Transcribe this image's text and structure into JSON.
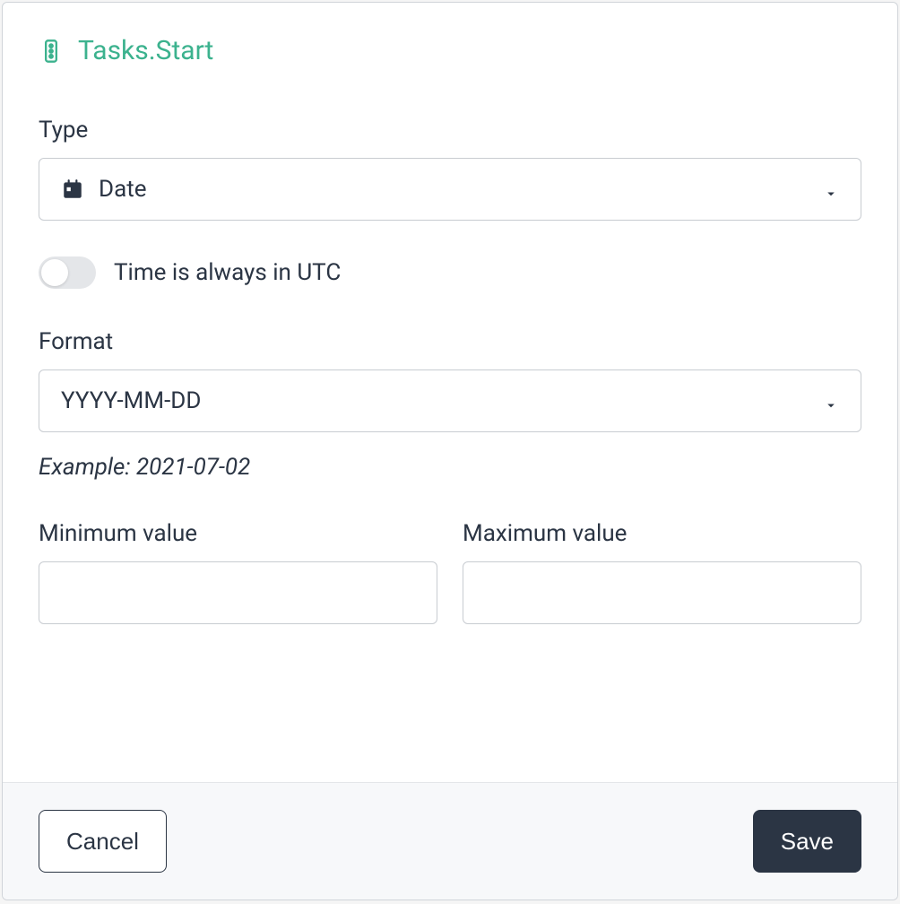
{
  "header": {
    "title": "Tasks.Start",
    "icon": "traffic-light-icon",
    "accent_color": "#3cb28e"
  },
  "form": {
    "type": {
      "label": "Type",
      "selected": "Date",
      "icon": "calendar-icon"
    },
    "utc_toggle": {
      "label": "Time is always in UTC",
      "enabled": false
    },
    "format": {
      "label": "Format",
      "selected": "YYYY-MM-DD"
    },
    "example": "Example: 2021-07-02",
    "min_value": {
      "label": "Minimum value",
      "value": ""
    },
    "max_value": {
      "label": "Maximum value",
      "value": ""
    }
  },
  "footer": {
    "cancel_label": "Cancel",
    "save_label": "Save"
  }
}
